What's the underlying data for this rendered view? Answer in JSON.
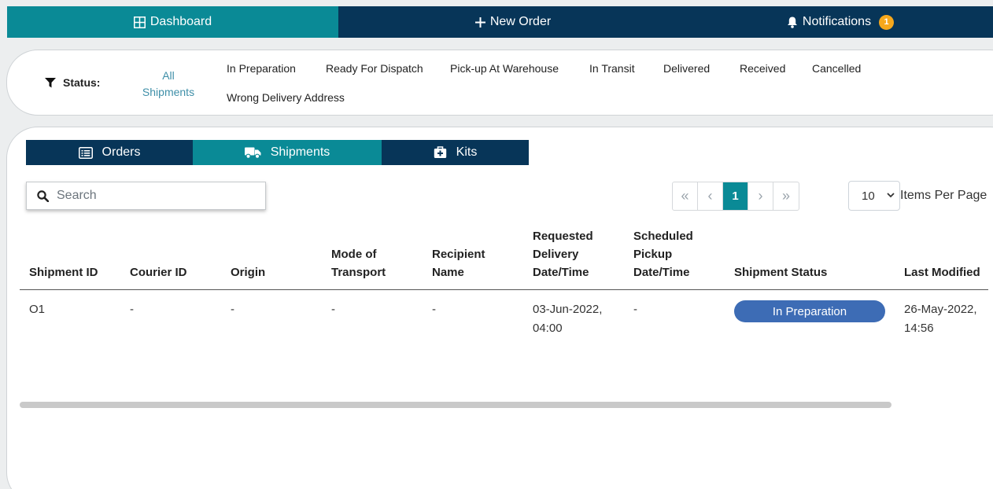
{
  "nav": {
    "dashboard": "Dashboard",
    "new_order": "New Order",
    "notifications": "Notifications",
    "notification_count": "1",
    "colors": {
      "active": "#0a8a96",
      "inactive": "#073558",
      "badge": "#f6a81c"
    }
  },
  "status_filter": {
    "label": "Status:",
    "all_line1": "All",
    "all_line2": "Shipments",
    "options": [
      "In Preparation",
      "Ready For Dispatch",
      "Pick-up At Warehouse",
      "In Transit",
      "Delivered",
      "Received",
      "Cancelled",
      "Wrong Delivery Address"
    ]
  },
  "tabs": {
    "orders": "Orders",
    "shipments": "Shipments",
    "kits": "Kits"
  },
  "search": {
    "placeholder": "Search",
    "value": ""
  },
  "pagination": {
    "first": "«",
    "prev": "‹",
    "current": "1",
    "next": "›",
    "last": "»"
  },
  "per_page": {
    "value": "10",
    "label": "Items Per Page"
  },
  "table": {
    "headers": {
      "shipment_id": "Shipment ID",
      "courier_id": "Courier ID",
      "origin": "Origin",
      "mode_l1": "Mode of",
      "mode_l2": "Transport",
      "recipient_l1": "Recipient",
      "recipient_l2": "Name",
      "req_l1": "Requested",
      "req_l2": "Delivery",
      "req_l3": "Date/Time",
      "sched_l1": "Scheduled",
      "sched_l2": "Pickup",
      "sched_l3": "Date/Time",
      "status": "Shipment Status",
      "last_modified": "Last Modified"
    },
    "rows": [
      {
        "shipment_id": "O1",
        "courier_id": "-",
        "origin": "-",
        "mode": "-",
        "recipient": "-",
        "requested_l1": "03-Jun-2022,",
        "requested_l2": "04:00",
        "scheduled": "-",
        "status": "In Preparation",
        "status_color": "#3d6cb5",
        "last_modified_l1": "26-May-2022,",
        "last_modified_l2": "14:56"
      }
    ]
  }
}
